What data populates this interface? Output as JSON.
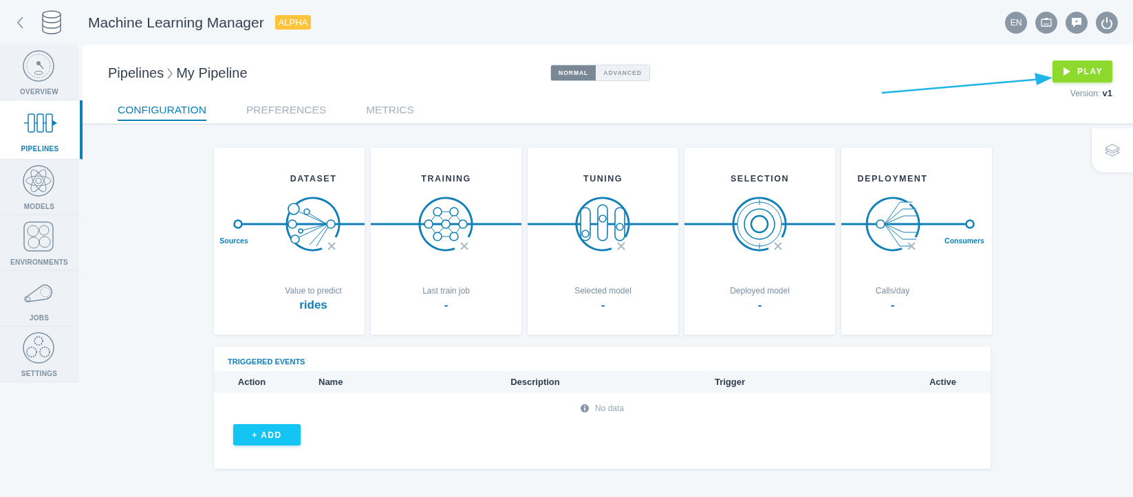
{
  "app": {
    "title": "Machine Learning Manager",
    "badge": "ALPHA"
  },
  "header_buttons": [
    {
      "kind": "language",
      "label": "EN"
    },
    {
      "kind": "id-card"
    },
    {
      "kind": "help"
    },
    {
      "kind": "power"
    }
  ],
  "sidebar": {
    "items": [
      {
        "label": "OVERVIEW",
        "kind": "gauge",
        "selected": false
      },
      {
        "label": "PIPELINES",
        "kind": "pipeline",
        "selected": true
      },
      {
        "label": "MODELS",
        "kind": "atom",
        "selected": false
      },
      {
        "label": "ENVIRONMENTS",
        "kind": "cells",
        "selected": false
      },
      {
        "label": "JOBS",
        "kind": "chain",
        "selected": false
      },
      {
        "label": "SETTINGS",
        "kind": "gears",
        "selected": false
      }
    ]
  },
  "breadcrumb": [
    "Pipelines",
    "My Pipeline"
  ],
  "mode_toggle": [
    {
      "label": "NORMAL",
      "selected": true
    },
    {
      "label": "ADVANCED",
      "selected": false
    }
  ],
  "play_button": {
    "label": "PLAY"
  },
  "version": {
    "label": "Version:",
    "value": "v1"
  },
  "tabs": [
    {
      "label": "CONFIGURATION",
      "selected": true
    },
    {
      "label": "PREFERENCES",
      "selected": false
    },
    {
      "label": "METRICS",
      "selected": false
    }
  ],
  "stages": [
    {
      "title": "DATASET",
      "kind": "dataset",
      "caption": "Value to predict",
      "value": "rides",
      "start_label": "Sources"
    },
    {
      "title": "TRAINING",
      "kind": "training",
      "caption": "Last train job",
      "value": "-"
    },
    {
      "title": "TUNING",
      "kind": "tuning",
      "caption": "Selected model",
      "value": "-"
    },
    {
      "title": "SELECTION",
      "kind": "selection",
      "caption": "Deployed model",
      "value": "-"
    },
    {
      "title": "DEPLOYMENT",
      "kind": "deployment",
      "caption": "Calls/day",
      "value": "-",
      "end_label": "Consumers"
    }
  ],
  "events": {
    "title": "TRIGGERED EVENTS",
    "columns": [
      "Action",
      "Name",
      "Description",
      "Trigger",
      "Active"
    ],
    "empty_text": "No data",
    "add_button": "+ ADD"
  }
}
